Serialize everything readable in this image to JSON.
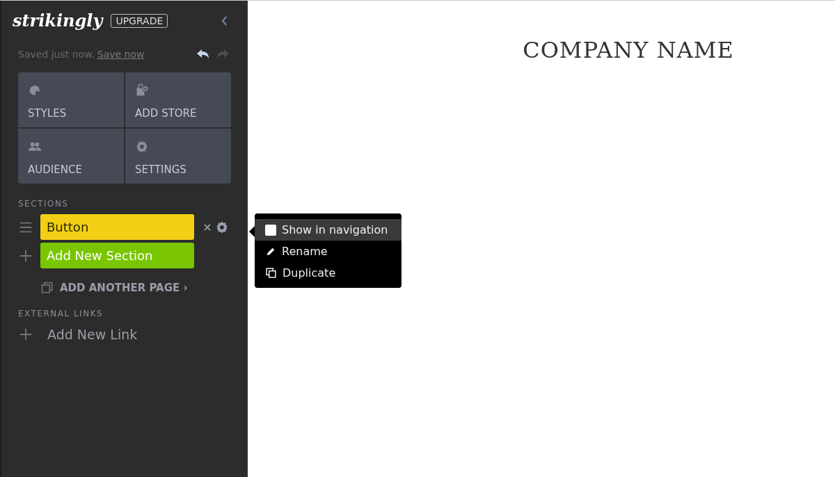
{
  "sidebar": {
    "logo": "strikingly",
    "upgrade": "UPGRADE",
    "save_status": "Saved just now.",
    "save_link": "Save now",
    "tiles": [
      {
        "label": "STYLES"
      },
      {
        "label": "ADD STORE"
      },
      {
        "label": "AUDIENCE"
      },
      {
        "label": "SETTINGS"
      }
    ],
    "sections_heading": "SECTIONS",
    "sections": [
      {
        "label": "Button",
        "kind": "section"
      },
      {
        "label": "Add New Section",
        "kind": "add"
      }
    ],
    "add_page": "ADD ANOTHER PAGE ›",
    "links_heading": "EXTERNAL LINKS",
    "add_link": "Add New Link"
  },
  "menu": {
    "items": [
      {
        "label": "Show in navigation",
        "kind": "checkbox",
        "checked": false,
        "highlighted": true
      },
      {
        "label": "Rename",
        "kind": "rename",
        "highlighted": false
      },
      {
        "label": "Duplicate",
        "kind": "duplicate",
        "highlighted": false
      }
    ]
  },
  "canvas": {
    "title": "COMPANY NAME"
  }
}
